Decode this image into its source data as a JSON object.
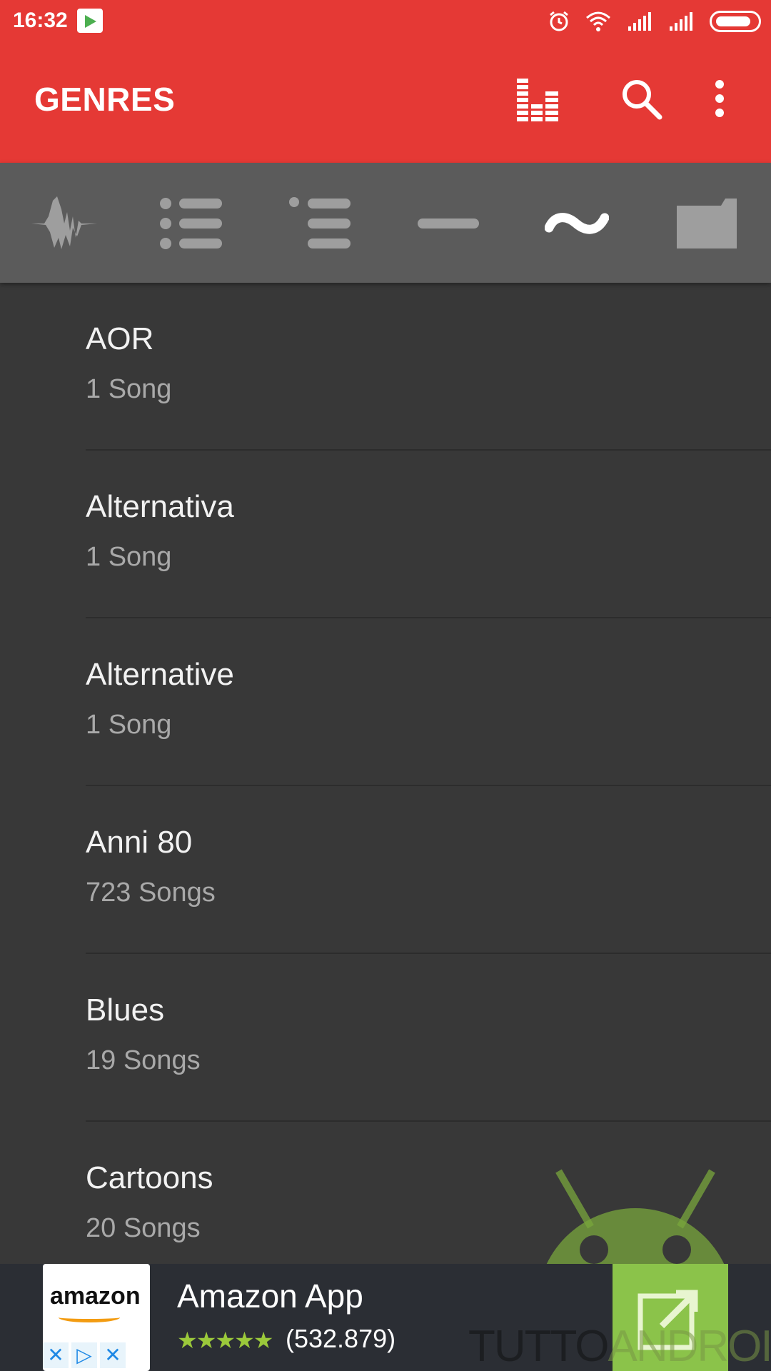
{
  "status_bar": {
    "time": "16:32",
    "icons": [
      "google-play-icon",
      "alarm-icon",
      "wifi-icon",
      "signal-icon",
      "signal-icon",
      "battery-icon"
    ]
  },
  "app_bar": {
    "title": "GENRES",
    "color": "#E53935",
    "actions": [
      "equalizer-icon",
      "search-icon",
      "more-vert-icon"
    ]
  },
  "tabs": {
    "items": [
      "waveform-icon",
      "list-icon",
      "sublist-icon",
      "line-icon",
      "tilde-icon",
      "folder-icon"
    ],
    "selected_index": 4
  },
  "genres": [
    {
      "name": "AOR",
      "count": "1 Song"
    },
    {
      "name": "Alternativa",
      "count": "1 Song"
    },
    {
      "name": "Alternative",
      "count": "1 Song"
    },
    {
      "name": "Anni 80",
      "count": "723 Songs"
    },
    {
      "name": "Blues",
      "count": "19 Songs"
    },
    {
      "name": "Cartoons",
      "count": "20 Songs"
    }
  ],
  "ad": {
    "logo_text": "amazon",
    "title": "Amazon App",
    "stars": "★★★★★",
    "rating_count": "(532.879)",
    "accent": "#8BC34A"
  },
  "watermark": {
    "text_a": "TUTTO",
    "text_b": "ANDROID"
  }
}
